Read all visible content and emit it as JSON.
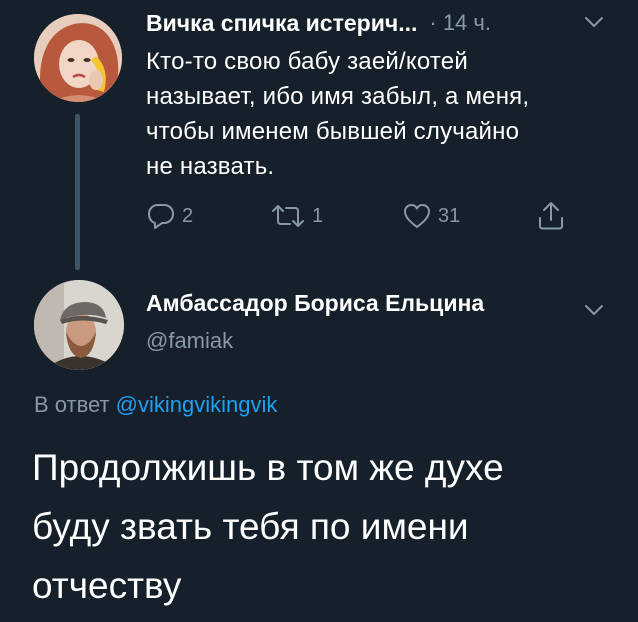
{
  "reply_to_tweet": {
    "author_name": "Вичка спичка истерич...",
    "time": "· 14 ч.",
    "text_lines": [
      "Кто-то свою бабу заей/котей",
      "называет, ибо имя забыл, а меня,",
      "чтобы именем бывшей случайно",
      "не назвать."
    ],
    "actions": {
      "reply_count": "2",
      "retweet_count": "1",
      "like_count": "31"
    }
  },
  "main_tweet": {
    "author_name": "Амбассадор Бориса Ельцина",
    "handle": "@famiak",
    "reply_prefix": "В ответ",
    "reply_mention": "@vikingvikingvik",
    "text_lines": [
      "Продолжишь в том же духе",
      "буду звать тебя по имени",
      "отчеству"
    ]
  },
  "colors": {
    "background": "#15202b",
    "secondary_text": "#8899a6",
    "link": "#1da1f2",
    "thread_line": "#3d5466"
  },
  "icons": [
    "reply-icon",
    "retweet-icon",
    "like-icon",
    "share-icon",
    "chevron-down-icon"
  ]
}
